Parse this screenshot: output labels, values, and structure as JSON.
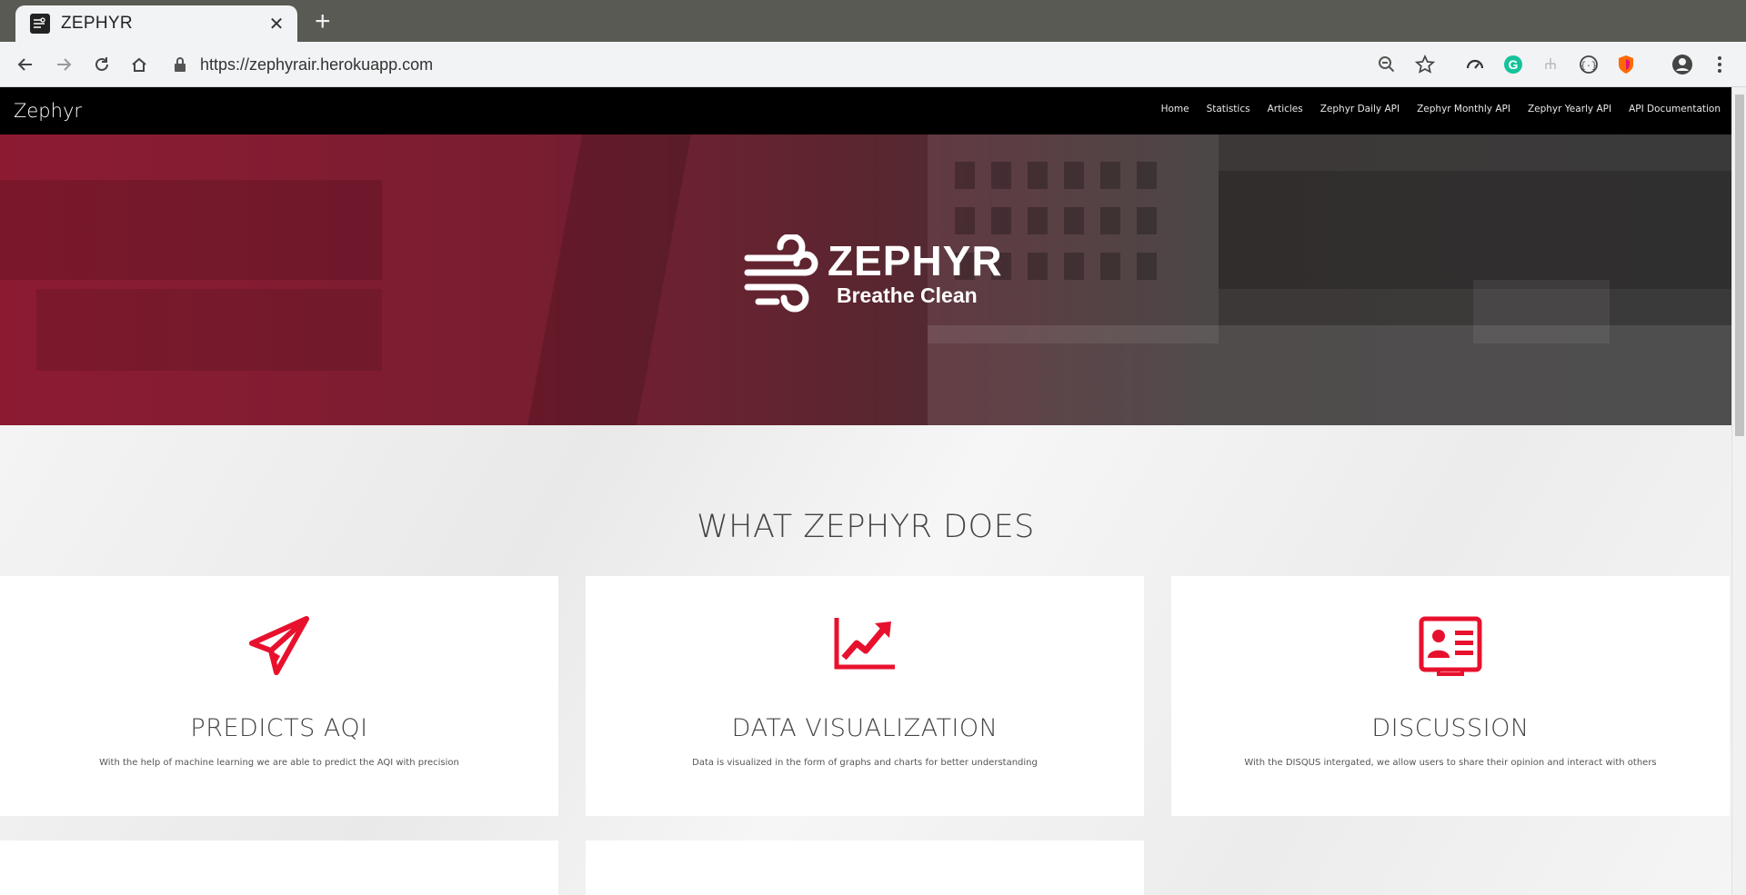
{
  "browser": {
    "tab_title": "ZEPHYR",
    "url": "https://zephyrair.herokuapp.com"
  },
  "site": {
    "brand": "Zephyr",
    "nav": [
      "Home",
      "Statistics",
      "Articles",
      "Zephyr Daily API",
      "Zephyr Monthly API",
      "Zephyr Yearly API",
      "API Documentation"
    ]
  },
  "hero": {
    "title": "ZEPHYR",
    "subtitle": "Breathe Clean"
  },
  "features": {
    "heading": "WHAT ZEPHYR DOES",
    "cards": [
      {
        "icon": "paper-plane-icon",
        "title": "PREDICTS AQI",
        "desc": "With the help of machine learning we are able to predict the AQI with precision"
      },
      {
        "icon": "line-chart-icon",
        "title": "DATA VISUALIZATION",
        "desc": "Data is visualized in the form of graphs and charts for better understanding"
      },
      {
        "icon": "id-card-icon",
        "title": "DISCUSSION",
        "desc": "With the DISQUS intergated, we allow users to share their opinion and interact with others"
      }
    ]
  },
  "colors": {
    "accent": "#e8112d",
    "navbar": "#000000"
  }
}
